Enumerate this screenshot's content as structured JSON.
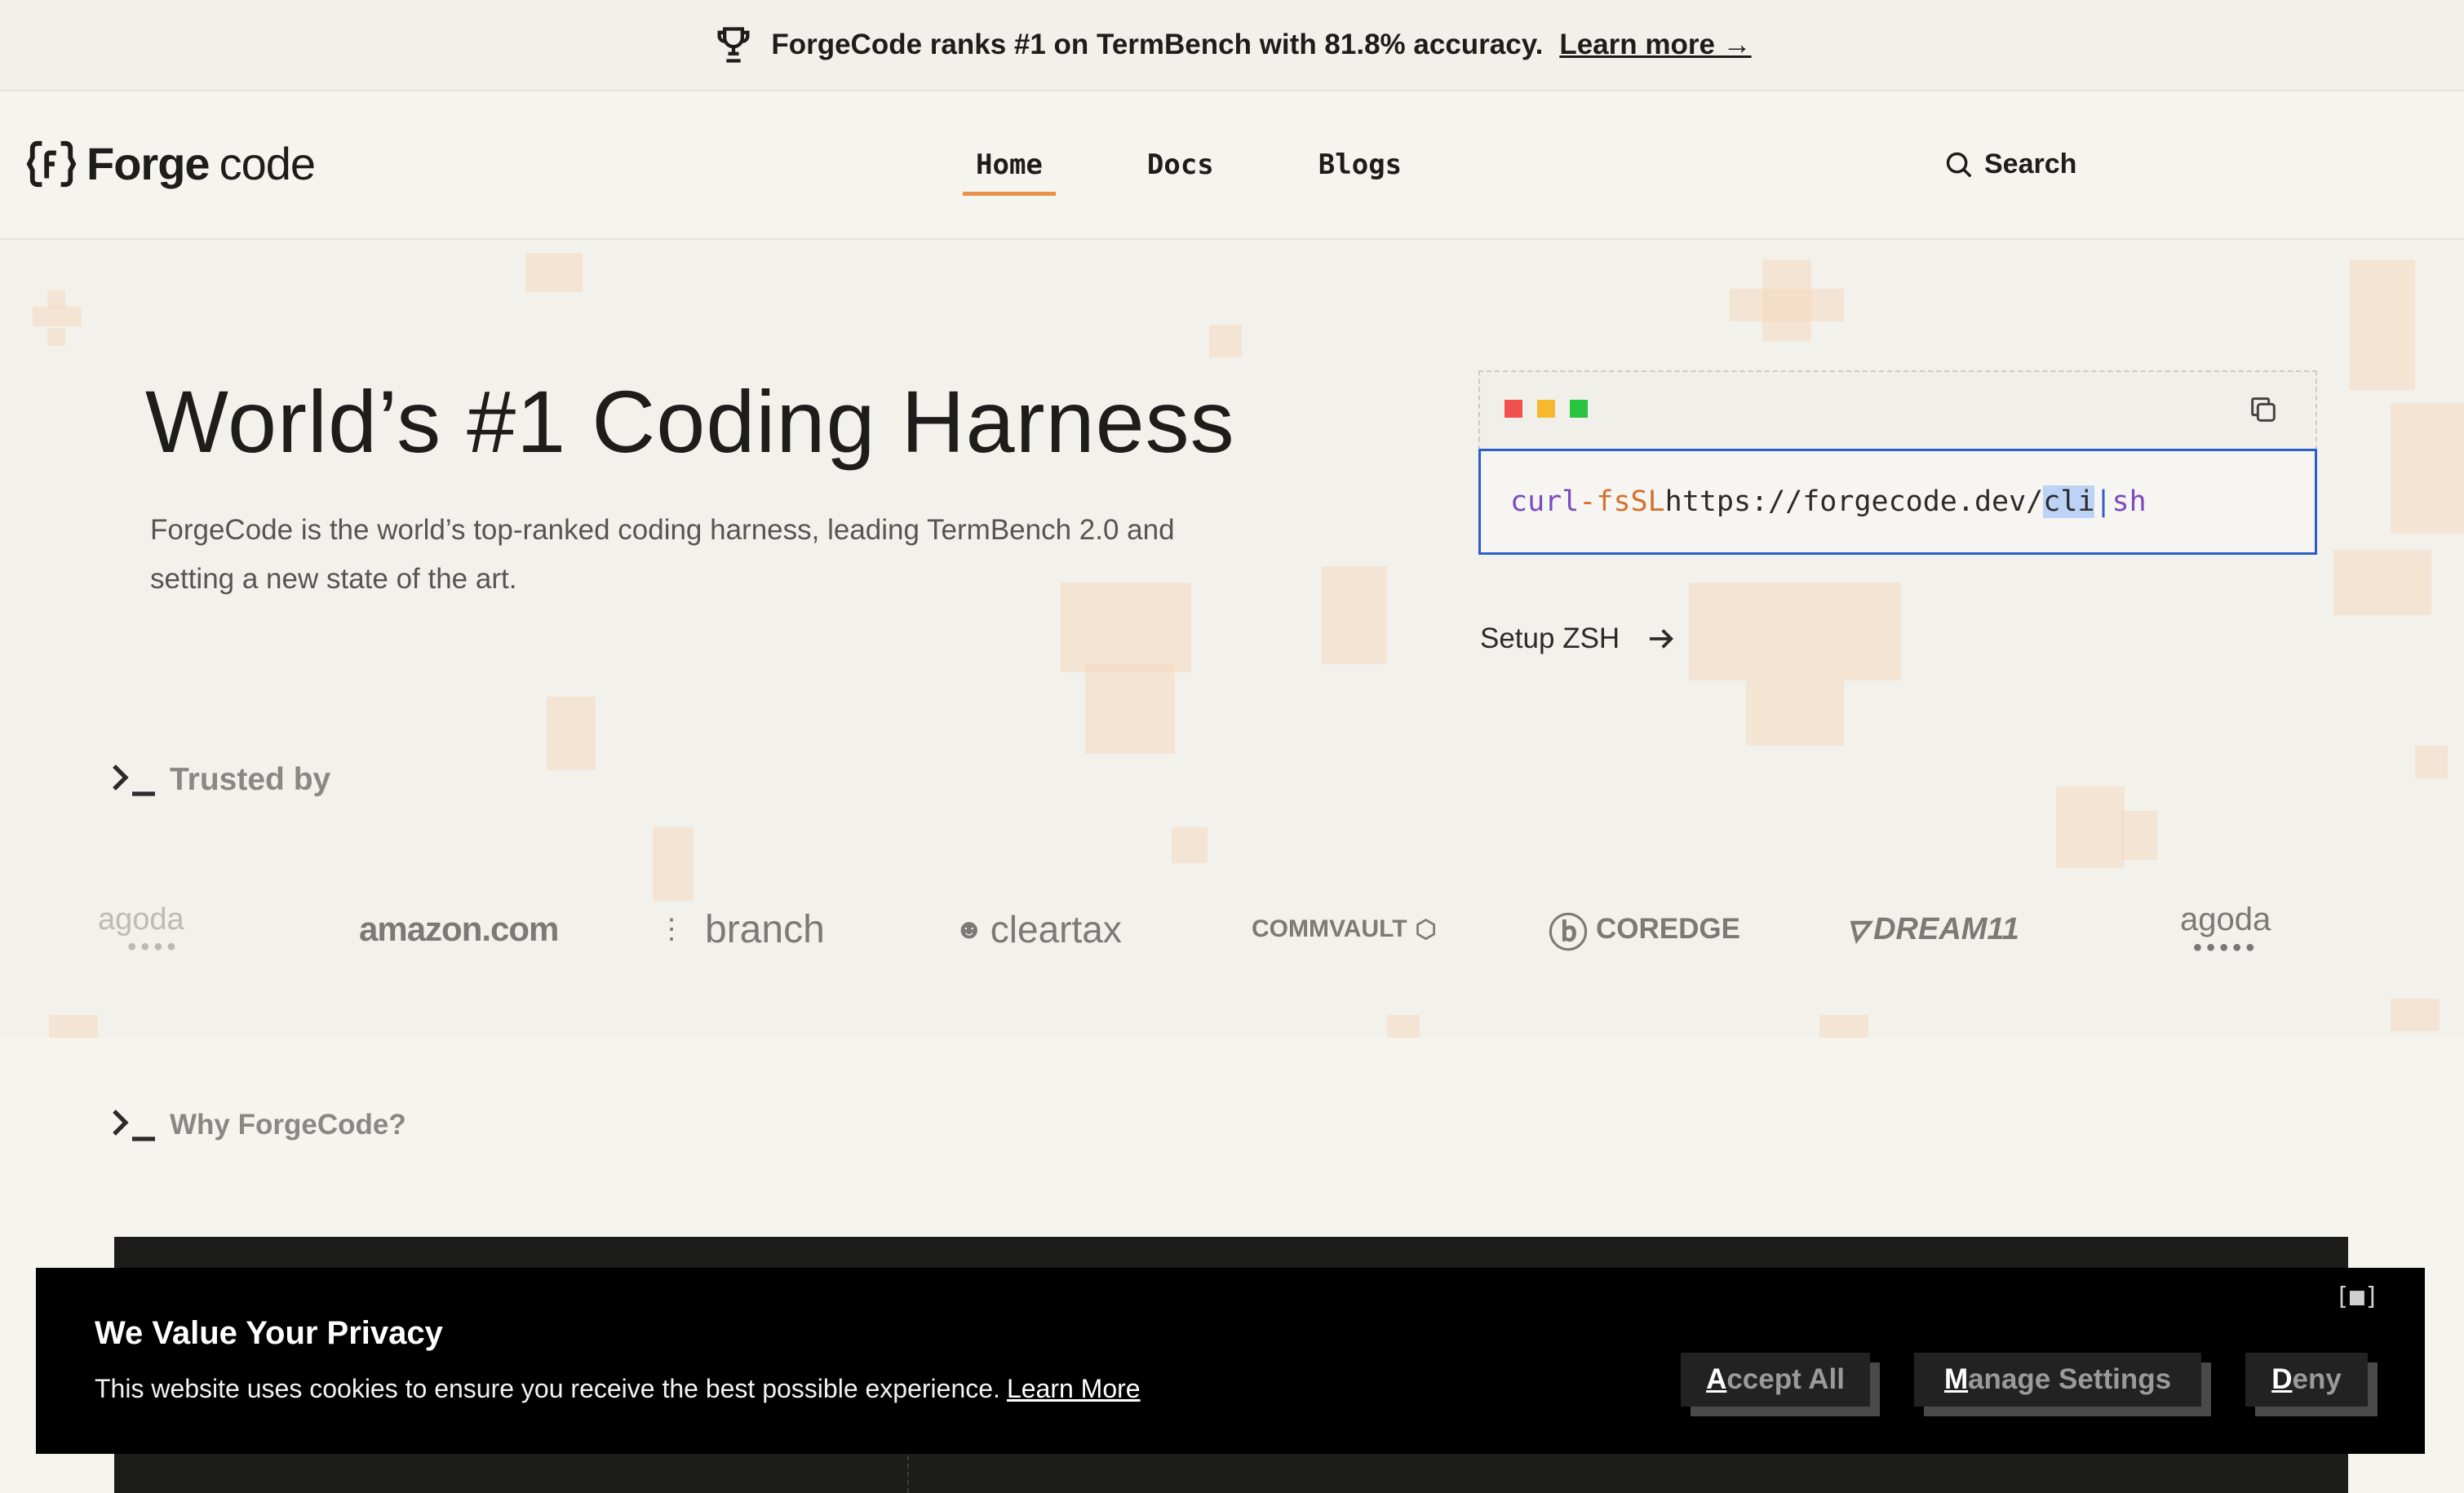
{
  "announcement": {
    "text": "ForgeCode ranks #1 on TermBench with 81.8% accuracy.",
    "link": "Learn more →",
    "icon": "trophy-icon"
  },
  "nav": {
    "logo_forge": "Forge",
    "logo_code": "code",
    "links": [
      "Home",
      "Docs",
      "Blogs"
    ],
    "active": "Home",
    "search": "Search"
  },
  "hero": {
    "title": "World’s #1 Coding Harness",
    "subtitle_line1": "ForgeCode is the world’s top-ranked coding harness, leading TermBench 2.0 and",
    "subtitle_line2": "setting a new state of the art.",
    "command": {
      "curl": "curl",
      "flag": "-fsSL",
      "url": "https://forgecode.dev/",
      "selected": "cli",
      "pipe": "|",
      "sh": "sh"
    },
    "setup_link": "Setup ZSH"
  },
  "trusted": {
    "label": "Trusted by",
    "logos": [
      "agoda",
      "amazon.com",
      "branch",
      "cleartax",
      "COMMVAULT",
      "COREDGE",
      "DREAM11",
      "agoda"
    ]
  },
  "why": {
    "label": "Why ForgeCode?"
  },
  "cookie": {
    "close": "[■]",
    "title": "We Value Your Privacy",
    "text": "This website uses cookies to ensure you receive the best possible experience.",
    "link": "Learn More",
    "accept_key": "A",
    "accept_rest": "ccept All",
    "manage_key": "M",
    "manage_rest": "anage Settings",
    "deny_key": "D",
    "deny_rest": "eny"
  },
  "colors": {
    "accent": "#e8914a",
    "command_border": "#2b5fc9",
    "dot_red": "#f0504f",
    "dot_yellow": "#f5b82e",
    "dot_green": "#29c440"
  }
}
